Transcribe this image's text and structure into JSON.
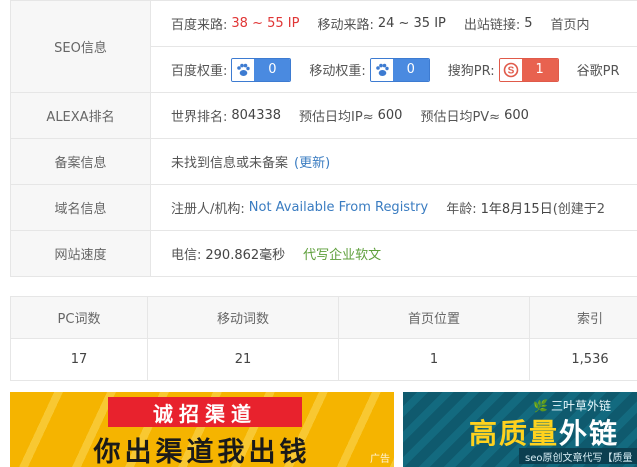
{
  "seo": {
    "label": "SEO信息",
    "baidu_traffic_label": "百度来路:",
    "baidu_traffic_value": "38 ~ 55 IP",
    "mobile_traffic_label": "移动来路:",
    "mobile_traffic_value": "24 ~ 35 IP",
    "outlinks_label": "出站链接:",
    "outlinks_value": "5",
    "homepage_inner_label": "首页内",
    "baidu_weight_label": "百度权重:",
    "baidu_weight_value": "0",
    "mobile_weight_label": "移动权重:",
    "mobile_weight_value": "0",
    "sogou_pr_label": "搜狗PR:",
    "sogou_pr_value": "1",
    "google_pr_label": "谷歌PR"
  },
  "alexa": {
    "label": "ALEXA排名",
    "world_rank_label": "世界排名:",
    "world_rank_value": "804338",
    "est_ip_label": "预估日均IP≈",
    "est_ip_value": "600",
    "est_pv_label": "预估日均PV≈",
    "est_pv_value": "600"
  },
  "icp": {
    "label": "备案信息",
    "text": "未找到信息或未备案",
    "update_link": "(更新)"
  },
  "domain": {
    "label": "域名信息",
    "registrant_label": "注册人/机构:",
    "registrant_value": "Not Available From Registry",
    "age_label": "年龄:",
    "age_value": "1年8月15日",
    "created_prefix": "(创建于2"
  },
  "speed": {
    "label": "网站速度",
    "telecom_label": "电信:",
    "telecom_value": "290.862毫秒",
    "link_text": "代写企业软文"
  },
  "stats": {
    "headers": [
      "PC词数",
      "移动词数",
      "首页位置",
      "索引"
    ],
    "values": [
      "17",
      "21",
      "1",
      "1,536"
    ]
  },
  "ads": {
    "left_top": "诚招渠道",
    "left_bottom": "你出渠道我出钱",
    "left_tag": "广告",
    "right_logo": "三叶草外链",
    "right_main_a": "高质量",
    "right_main_b": "外链",
    "right_sub": "seo原创文章代写【质量"
  },
  "colors": {
    "red_value": "#e03636",
    "blue_link": "#3a7cc1",
    "green_link": "#5e9f3b",
    "baidu_badge": "#4a8ae0",
    "sogou_badge": "#e8624f",
    "ad_left_bg": "#f5b400",
    "ad_right_bg": "#0f5a6e"
  },
  "icons": [
    "baidu-paw-icon",
    "mobile-paw-icon",
    "sogou-s-icon",
    "leaf-icon"
  ]
}
